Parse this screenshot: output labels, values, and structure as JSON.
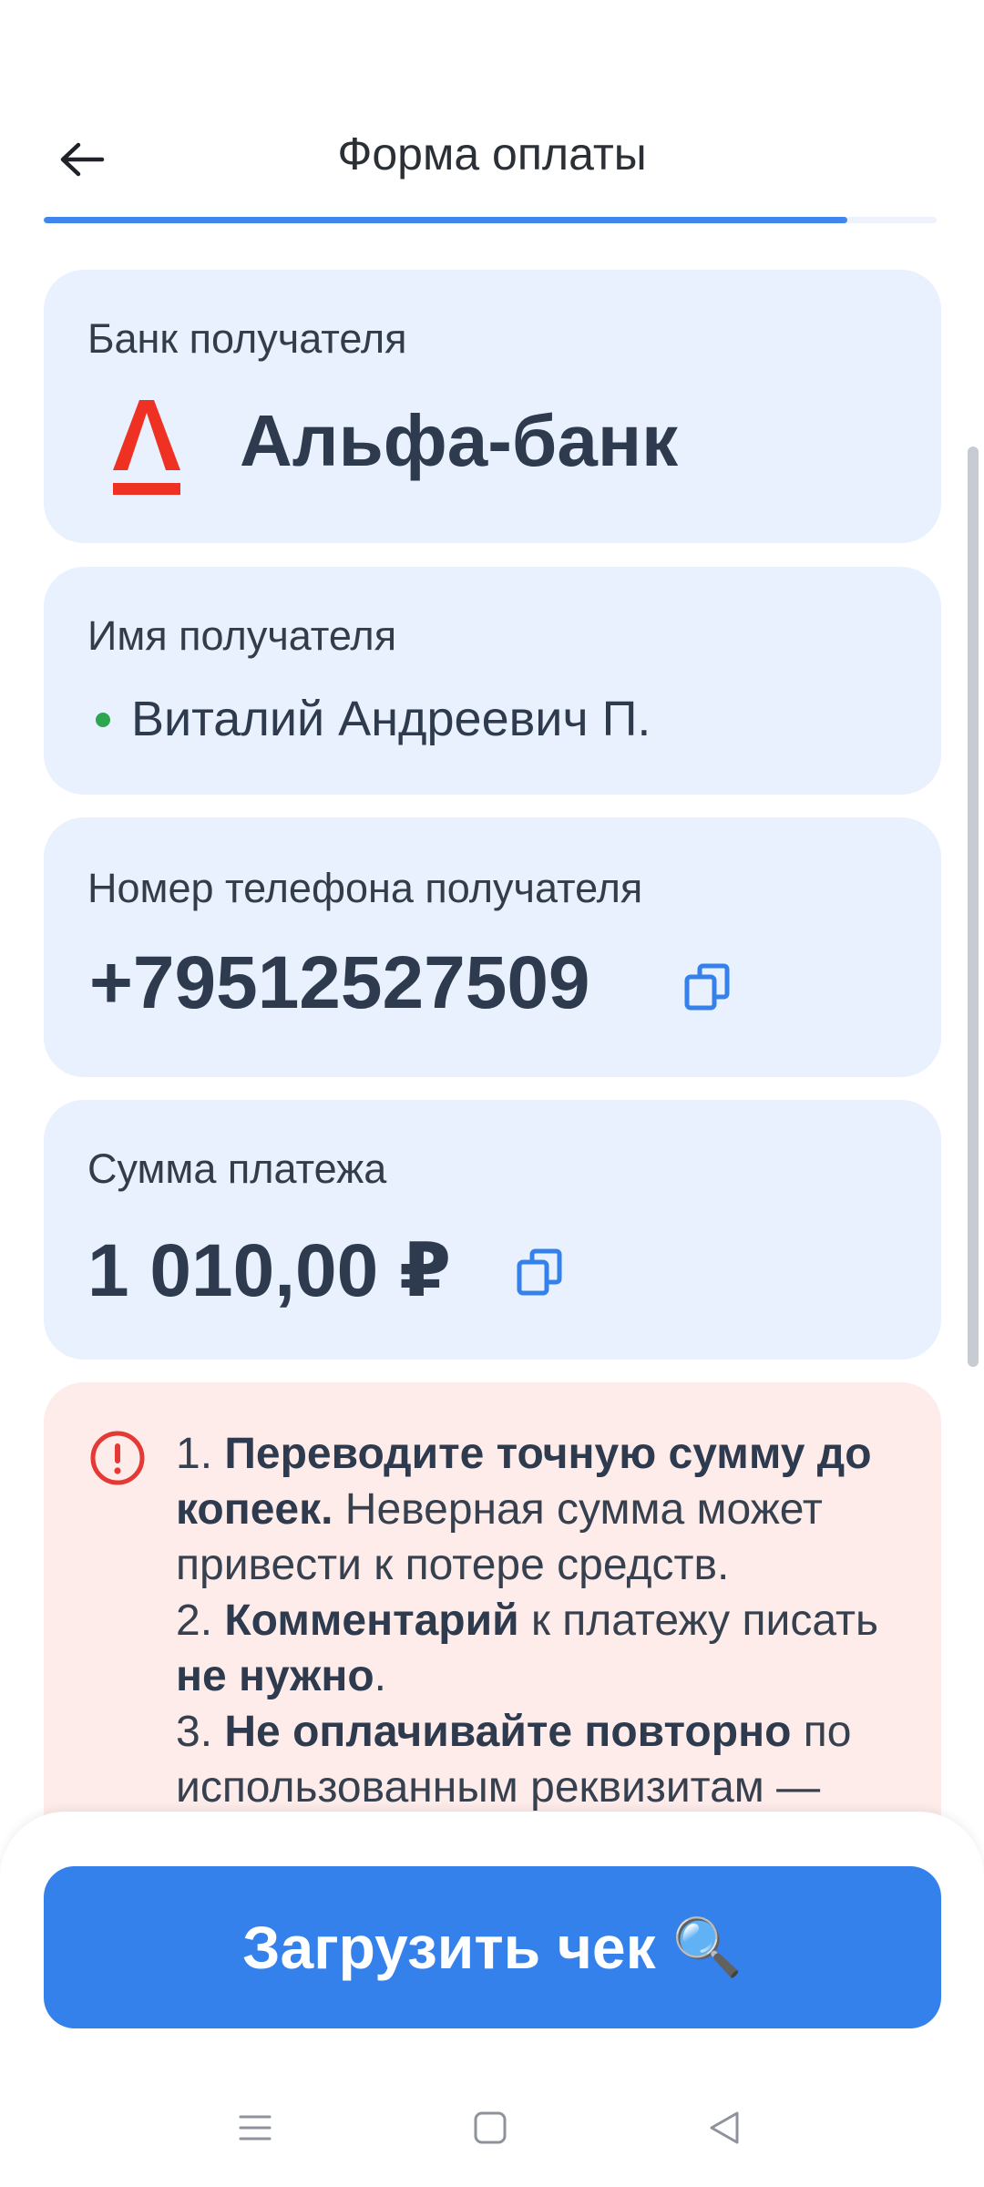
{
  "header": {
    "title": "Форма оплаты",
    "progress_fraction": 0.9
  },
  "bank_card": {
    "label": "Банк получателя",
    "bank_name": "Альфа-банк",
    "logo_icon": "alfa-bank-logo",
    "logo_color": "#ef3124"
  },
  "recipient_card": {
    "label": "Имя получателя",
    "name": "Виталий Андреевич П.",
    "status_color": "#2ea64f"
  },
  "phone_card": {
    "label": "Номер телефона получателя",
    "value": "+79512527509",
    "copy_icon": "copy-icon"
  },
  "sum_card": {
    "label": "Сумма платежа",
    "value": "1 010,00 ₽",
    "copy_icon": "copy-icon"
  },
  "warning": {
    "icon": "alert-circle-icon",
    "item1_num": "1.",
    "item1_bold": "Переводите точную сумму до копеек.",
    "item1_rest": "Неверная сумма может привести к потере средств.",
    "item2_num": "2.",
    "item2_bold": "Комментарий",
    "item2_mid": "к платежу писать",
    "item2_bold2": "не нужно",
    "item2_end": ".",
    "item3_num": "3.",
    "item3_bold": "Не оплачивайте повторно",
    "item3_rest": "по использованным реквизитам —"
  },
  "footer": {
    "upload_label": "Загрузить чек",
    "upload_emoji": "🔍",
    "accent_color": "#3481ec"
  },
  "nav": {
    "icons": [
      "menu-icon",
      "home-icon",
      "back-triangle-icon"
    ]
  }
}
